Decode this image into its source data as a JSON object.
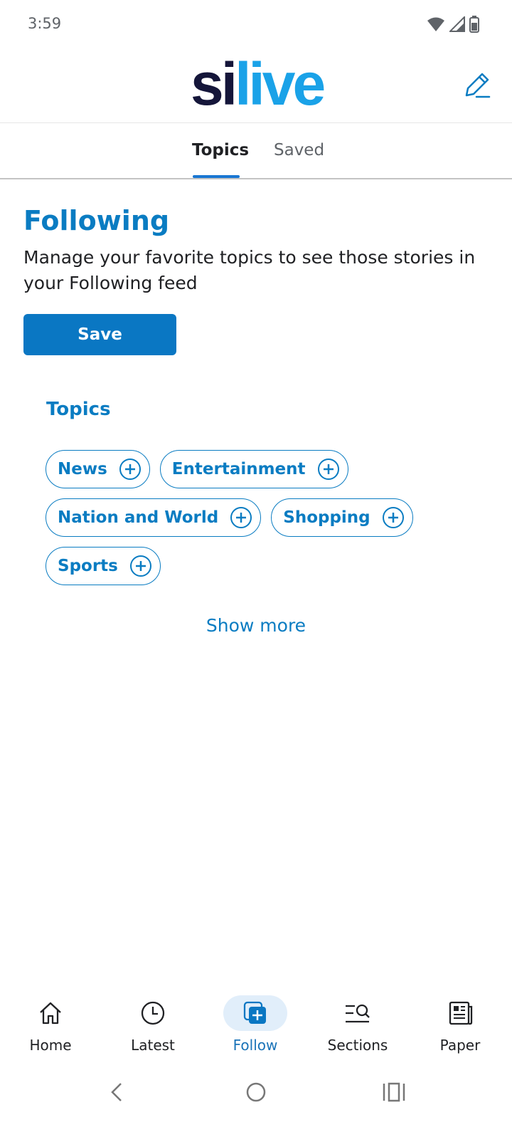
{
  "status_bar": {
    "time": "3:59",
    "icons": [
      "wifi-icon",
      "signal-icon",
      "battery-icon"
    ]
  },
  "header": {
    "logo_part1": "si",
    "logo_part2": "live",
    "edit_icon": "pencil-icon",
    "colors": {
      "logo_dark": "#15163a",
      "logo_blue": "#1aa2e8",
      "accent": "#0a7cc2"
    }
  },
  "tabs": [
    {
      "label": "Topics",
      "active": true
    },
    {
      "label": "Saved",
      "active": false
    }
  ],
  "main": {
    "title": "Following",
    "description": "Manage your favorite topics to see those stories in your Following feed",
    "save_label": "Save",
    "topics_heading": "Topics",
    "topics": [
      {
        "label": "News",
        "icon": "plus-circle-icon"
      },
      {
        "label": "Entertainment",
        "icon": "plus-circle-icon"
      },
      {
        "label": "Nation and World",
        "icon": "plus-circle-icon"
      },
      {
        "label": "Shopping",
        "icon": "plus-circle-icon"
      },
      {
        "label": "Sports",
        "icon": "plus-circle-icon"
      }
    ],
    "show_more": "Show more"
  },
  "bottom_nav": [
    {
      "label": "Home",
      "icon": "home-icon",
      "active": false
    },
    {
      "label": "Latest",
      "icon": "clock-icon",
      "active": false
    },
    {
      "label": "Follow",
      "icon": "follow-icon",
      "active": true
    },
    {
      "label": "Sections",
      "icon": "sections-search-icon",
      "active": false
    },
    {
      "label": "Paper",
      "icon": "newspaper-icon",
      "active": false
    }
  ],
  "system_nav": [
    "back-icon",
    "home-circle-icon",
    "recents-icon"
  ]
}
